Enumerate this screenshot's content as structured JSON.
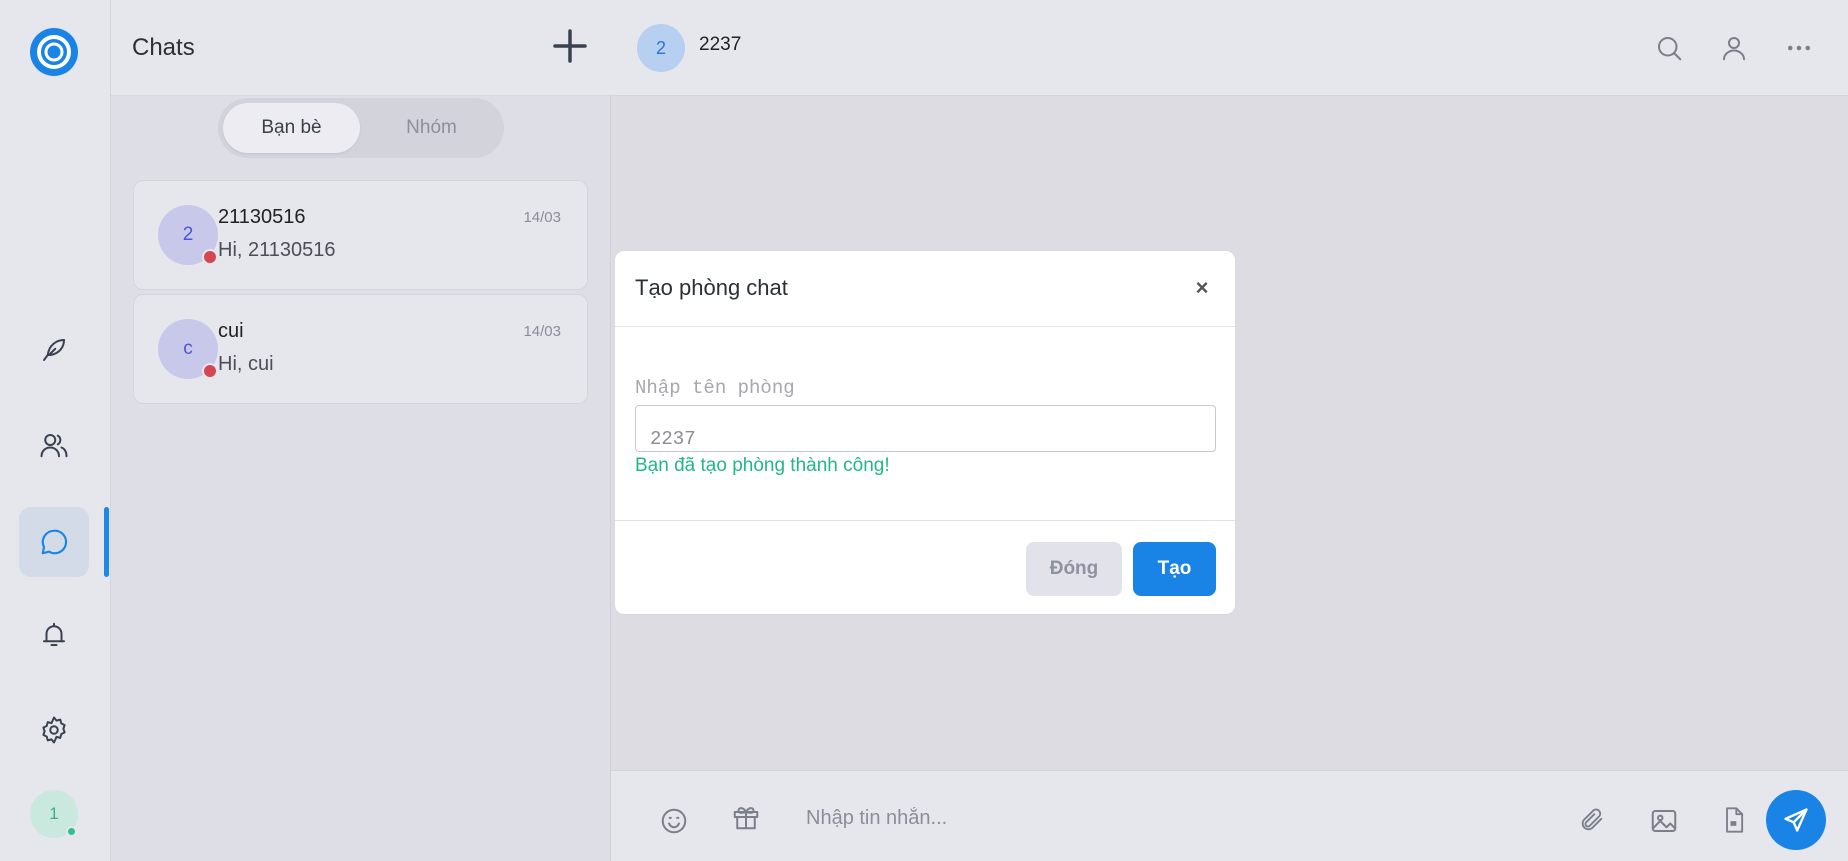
{
  "colors": {
    "accent": "#1a83e6",
    "success": "#22b78a",
    "unread_dot": "#d64552",
    "online_dot": "#2ec28f"
  },
  "rail": {
    "items": [
      {
        "name": "feather-icon"
      },
      {
        "name": "users-icon"
      },
      {
        "name": "chat-icon",
        "active": true
      },
      {
        "name": "bell-icon"
      },
      {
        "name": "gear-icon"
      }
    ],
    "user_avatar": "1"
  },
  "list": {
    "title": "Chats",
    "tabs": {
      "friends": "Bạn bè",
      "groups": "Nhóm"
    },
    "chats": [
      {
        "avatar": "2",
        "name": "21130516",
        "preview": "Hi, 21130516",
        "time": "14/03"
      },
      {
        "avatar": "c",
        "name": "cui",
        "preview": "Hi, cui",
        "time": "14/03"
      }
    ]
  },
  "main": {
    "avatar": "2",
    "title": "2237",
    "composer_placeholder": "Nhập tin nhắn..."
  },
  "modal": {
    "title": "Tạo phòng chat",
    "close_symbol": "×",
    "label": "Nhập tên phòng",
    "input_value": "2237",
    "success": "Bạn đã tạo phòng thành công!",
    "cancel": "Đóng",
    "submit": "Tạo"
  }
}
